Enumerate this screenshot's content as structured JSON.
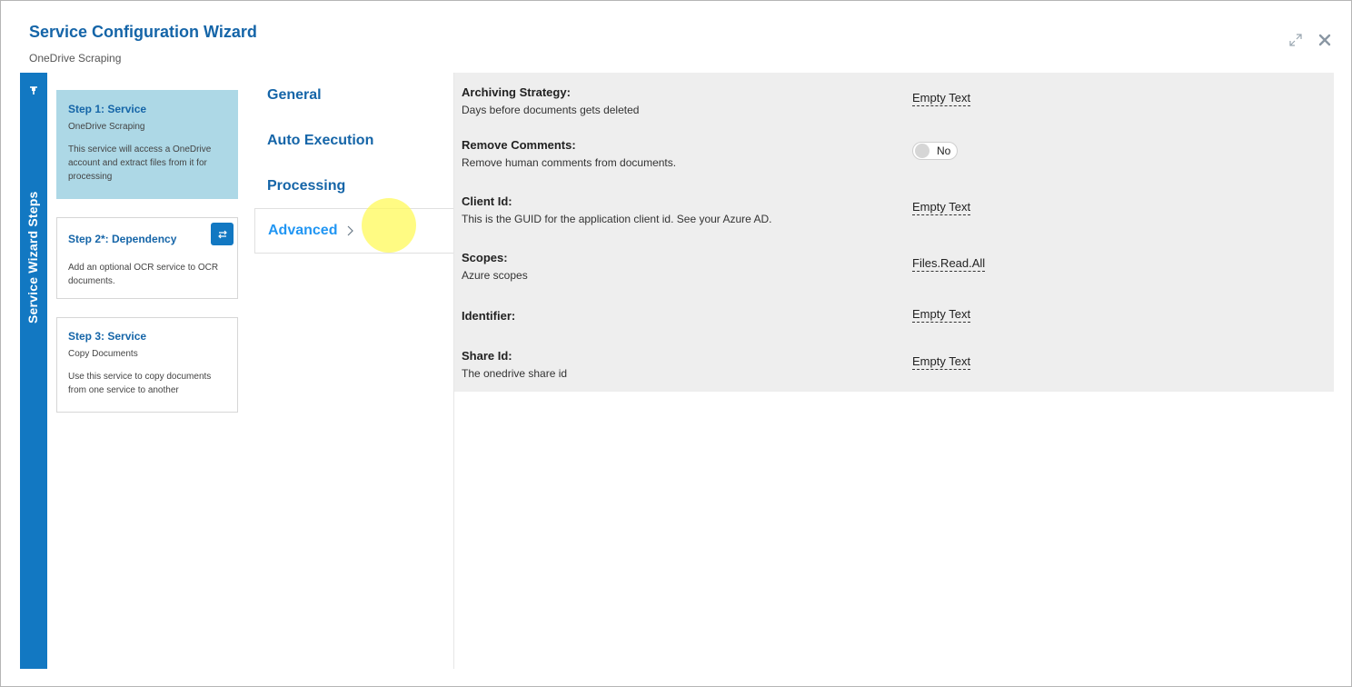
{
  "header": {
    "title": "Service Configuration Wizard",
    "subtitle": "OneDrive Scraping"
  },
  "sidebar": {
    "label": "Service Wizard Steps",
    "pin_icon": "pin-icon"
  },
  "steps": [
    {
      "title": "Step 1: Service",
      "subtitle": "OneDrive Scraping",
      "description": "This service will access a OneDrive account and extract files from it for processing",
      "active": true
    },
    {
      "title": "Step 2*: Dependency",
      "subtitle": "",
      "description": "Add an optional OCR service to OCR documents.",
      "icon": "swap-icon"
    },
    {
      "title": "Step 3: Service",
      "subtitle": "Copy Documents",
      "description": "Use this service to copy documents from one service to another"
    }
  ],
  "nav": {
    "items": [
      "General",
      "Auto Execution",
      "Processing",
      "Advanced"
    ],
    "selected": "Advanced"
  },
  "settings": [
    {
      "label": "Archiving Strategy:",
      "description": "Days before documents gets deleted",
      "value": "Empty Text"
    },
    {
      "label": "Remove Comments:",
      "description": "Remove human comments from documents.",
      "toggle": "No"
    },
    {
      "label": "Client Id:",
      "description": "This is the GUID for the application client id. See your Azure AD.",
      "value": "Empty Text"
    },
    {
      "label": "Scopes:",
      "description": "Azure scopes",
      "value": "Files.Read.All"
    },
    {
      "label": "Identifier:",
      "description": "",
      "value": "Empty Text"
    },
    {
      "label": "Share Id:",
      "description": "The onedrive share id",
      "value": "Empty Text"
    }
  ],
  "colors": {
    "accent": "#1278c2",
    "title": "#1565a8",
    "active_step": "#add8e6",
    "panel_bg": "#eeeeee"
  }
}
